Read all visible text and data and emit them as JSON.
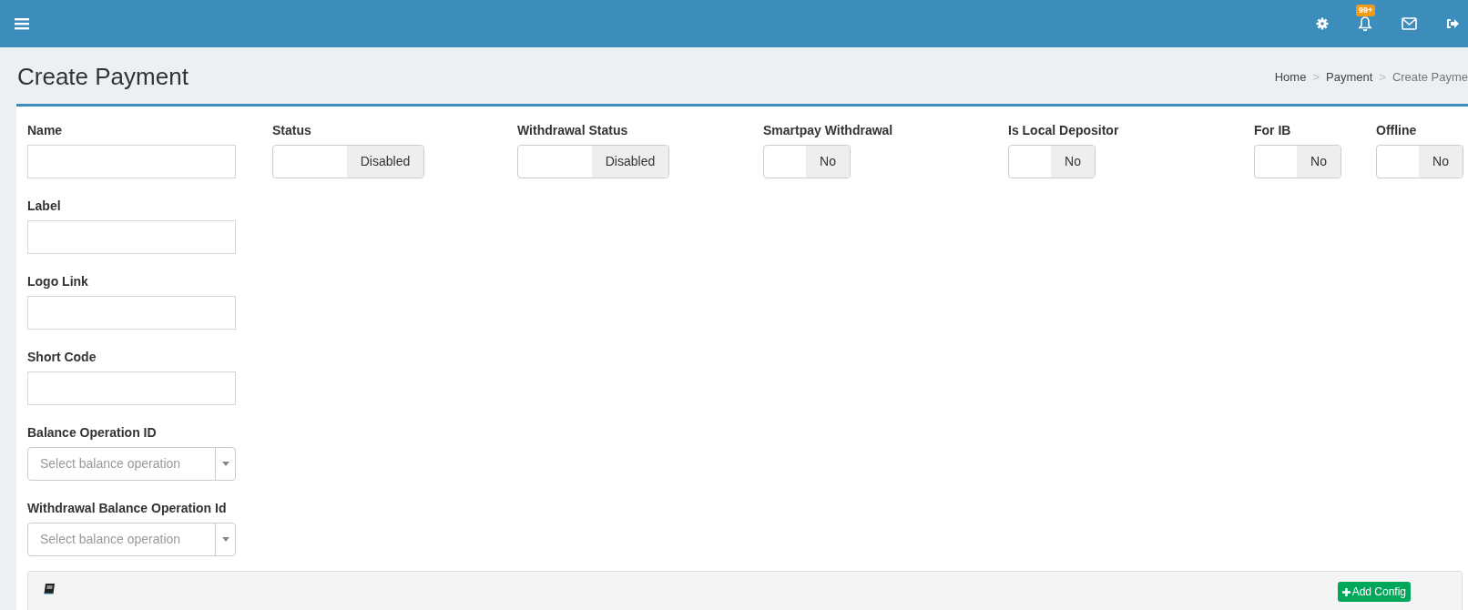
{
  "header": {
    "notification_badge": "99+"
  },
  "page": {
    "title": "Create Payment",
    "breadcrumb": [
      "Home",
      "Payment",
      "Create Payme"
    ],
    "breadcrumb_separator": ">"
  },
  "toggles": [
    {
      "label": "Status",
      "value": "Disabled",
      "on": false
    },
    {
      "label": "Withdrawal Status",
      "value": "Disabled",
      "on": false
    },
    {
      "label": "Smartpay Withdrawal",
      "value": "No",
      "on": false
    },
    {
      "label": "Is Local Depositor",
      "value": "No",
      "on": false
    },
    {
      "label": "For IB",
      "value": "No",
      "on": false
    },
    {
      "label": "Offline",
      "value": "No",
      "on": false
    }
  ],
  "fields": [
    {
      "kind": "text",
      "label": "Name"
    },
    {
      "kind": "text",
      "label": "Label"
    },
    {
      "kind": "text",
      "label": "Logo Link"
    },
    {
      "kind": "text",
      "label": "Short Code"
    },
    {
      "kind": "select",
      "label": "Balance Operation ID",
      "placeholder": "Select balance operation"
    },
    {
      "kind": "select",
      "label": "Withdrawal Balance Operation Id",
      "placeholder": "Select balance operation"
    }
  ],
  "config_panel": {
    "button": "Add Config"
  }
}
